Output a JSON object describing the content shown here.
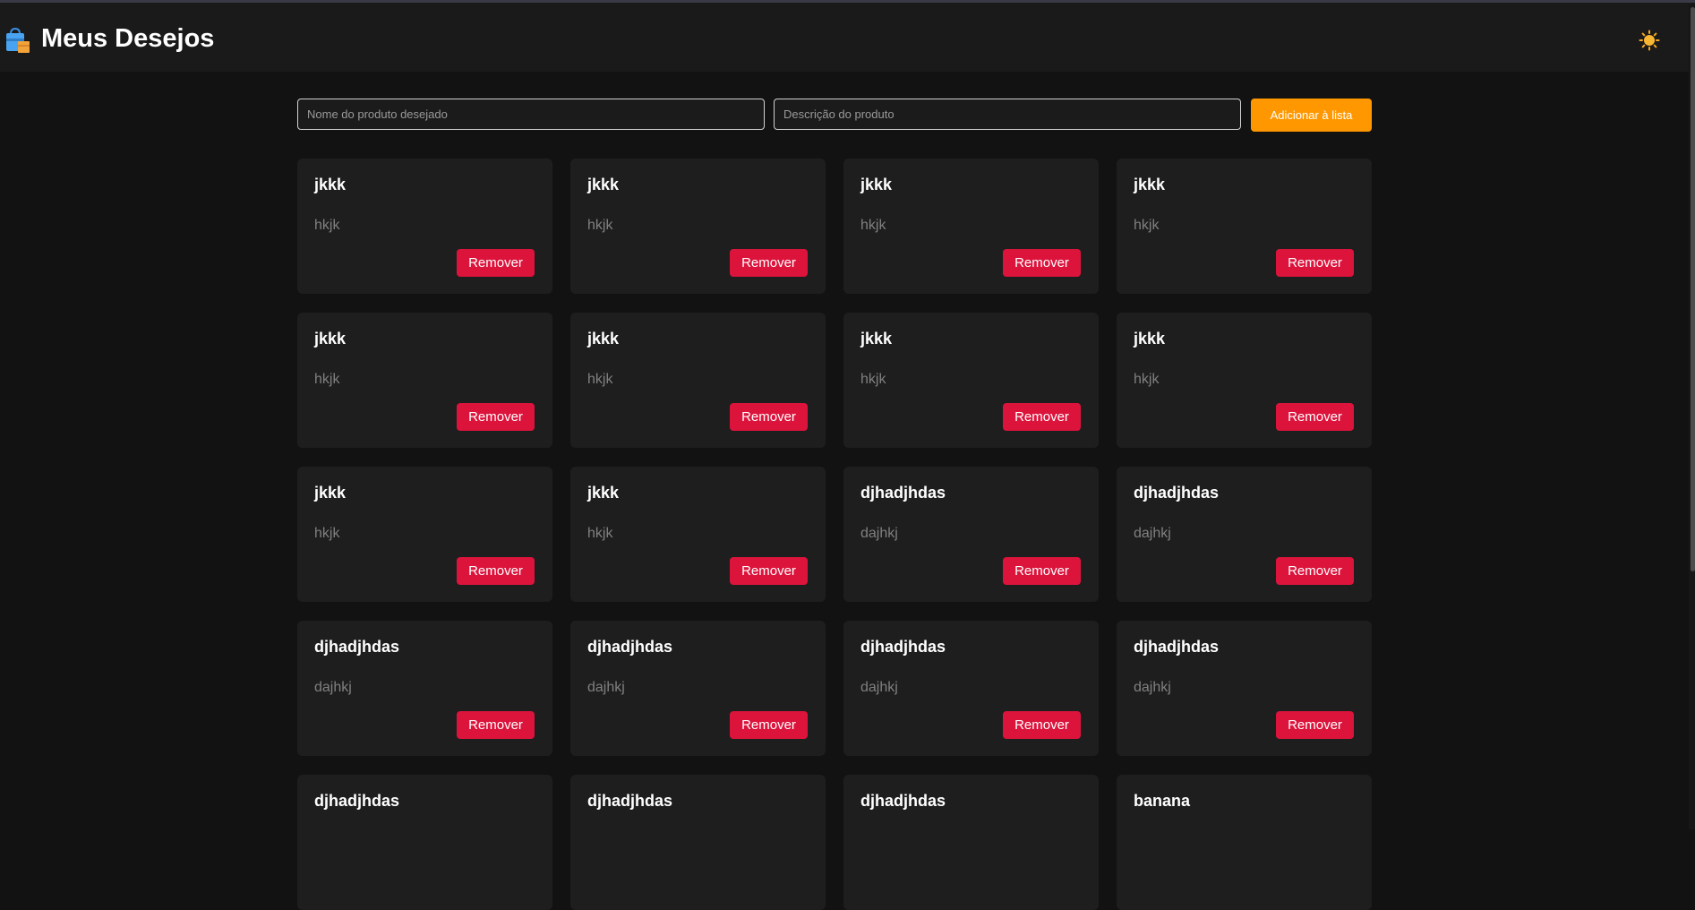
{
  "header": {
    "title": "Meus Desejos",
    "logo_icon": "shopping-bag-icon",
    "theme_icon": "sun-icon"
  },
  "form": {
    "name_placeholder": "Nome do produto desejado",
    "name_value": "",
    "description_placeholder": "Descrição do produto",
    "description_value": "",
    "add_label": "Adicionar à lista"
  },
  "colors": {
    "accent": "#ff9800",
    "danger": "#dc143c",
    "background": "#121212",
    "card": "#1e1e1f"
  },
  "remove_label": "Remover",
  "items": [
    {
      "title": "jkkk",
      "description": "hkjk"
    },
    {
      "title": "jkkk",
      "description": "hkjk"
    },
    {
      "title": "jkkk",
      "description": "hkjk"
    },
    {
      "title": "jkkk",
      "description": "hkjk"
    },
    {
      "title": "jkkk",
      "description": "hkjk"
    },
    {
      "title": "jkkk",
      "description": "hkjk"
    },
    {
      "title": "jkkk",
      "description": "hkjk"
    },
    {
      "title": "jkkk",
      "description": "hkjk"
    },
    {
      "title": "jkkk",
      "description": "hkjk"
    },
    {
      "title": "jkkk",
      "description": "hkjk"
    },
    {
      "title": "djhadjhdas",
      "description": "dajhkj"
    },
    {
      "title": "djhadjhdas",
      "description": "dajhkj"
    },
    {
      "title": "djhadjhdas",
      "description": "dajhkj"
    },
    {
      "title": "djhadjhdas",
      "description": "dajhkj"
    },
    {
      "title": "djhadjhdas",
      "description": "dajhkj"
    },
    {
      "title": "djhadjhdas",
      "description": "dajhkj"
    },
    {
      "title": "djhadjhdas"
    },
    {
      "title": "djhadjhdas"
    },
    {
      "title": "djhadjhdas"
    },
    {
      "title": "banana"
    }
  ]
}
